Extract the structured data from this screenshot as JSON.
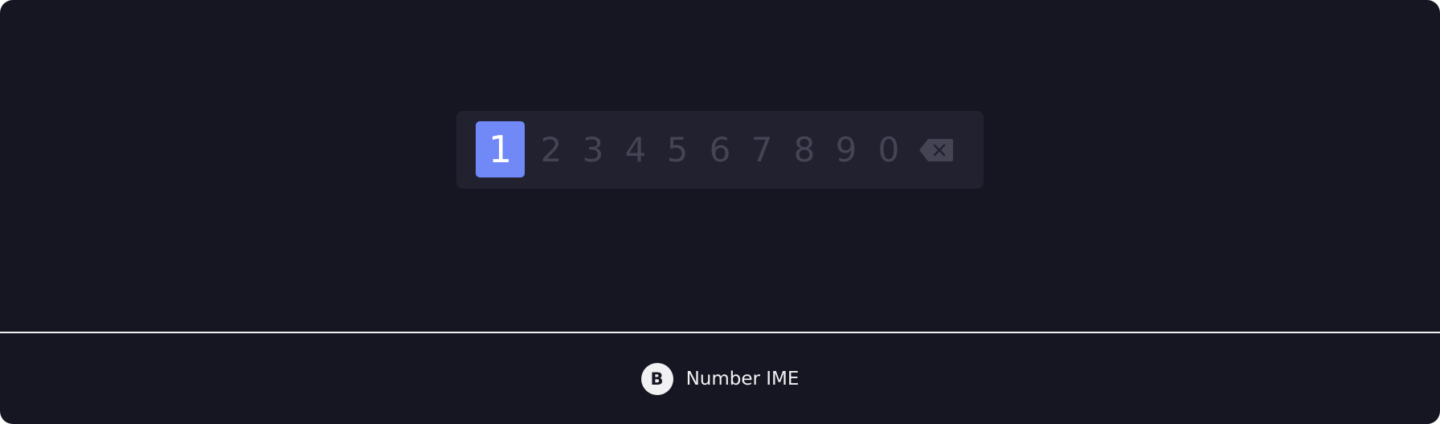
{
  "ime": {
    "selected_key": "1",
    "keys": [
      "1",
      "2",
      "3",
      "4",
      "5",
      "6",
      "7",
      "8",
      "9",
      "0"
    ],
    "backspace_icon": "backspace-icon"
  },
  "legend": {
    "badge": "B",
    "label": "Number IME"
  },
  "colors": {
    "background": "#161622",
    "bar": "#212130",
    "accent": "#7188f7",
    "key_inactive": "#444455",
    "text_light": "#f1f1f3"
  }
}
